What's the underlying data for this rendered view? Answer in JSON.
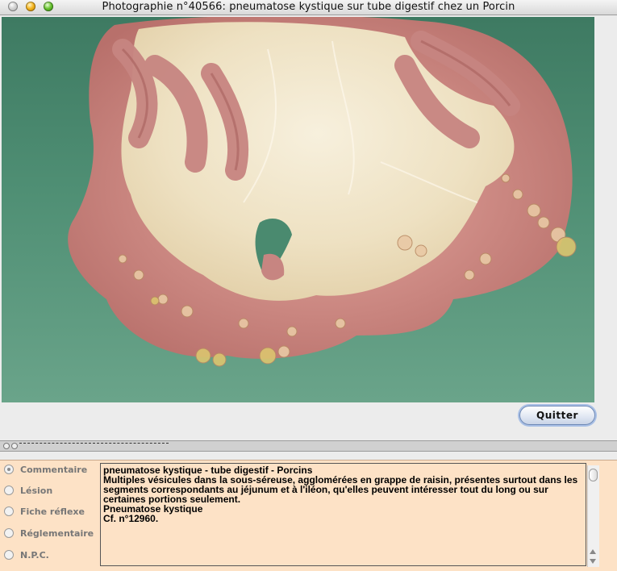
{
  "window": {
    "title": "Photographie n°40566: pneumatose kystique sur tube digestif chez un Porcin"
  },
  "buttons": {
    "quit_label": "Quitter"
  },
  "options": [
    {
      "label": "Commentaire",
      "checked": true
    },
    {
      "label": "Lésion",
      "checked": false
    },
    {
      "label": "Fiche réflexe",
      "checked": false
    },
    {
      "label": "Réglementaire",
      "checked": false
    },
    {
      "label": "N.P.C.",
      "checked": false
    }
  ],
  "comment": {
    "lines": [
      "pneumatose kystique - tube digestif - Porcins",
      "Multiples vésicules dans la sous-séreuse, agglomérées en grappe de raisin, présentes surtout dans les segments correspondants au jéjunum et à l'iléon, qu'elles peuvent intéresser tout du long ou sur certaines portions seulement.",
      "Pneumatose kystique",
      "Cf. n°12960."
    ]
  }
}
